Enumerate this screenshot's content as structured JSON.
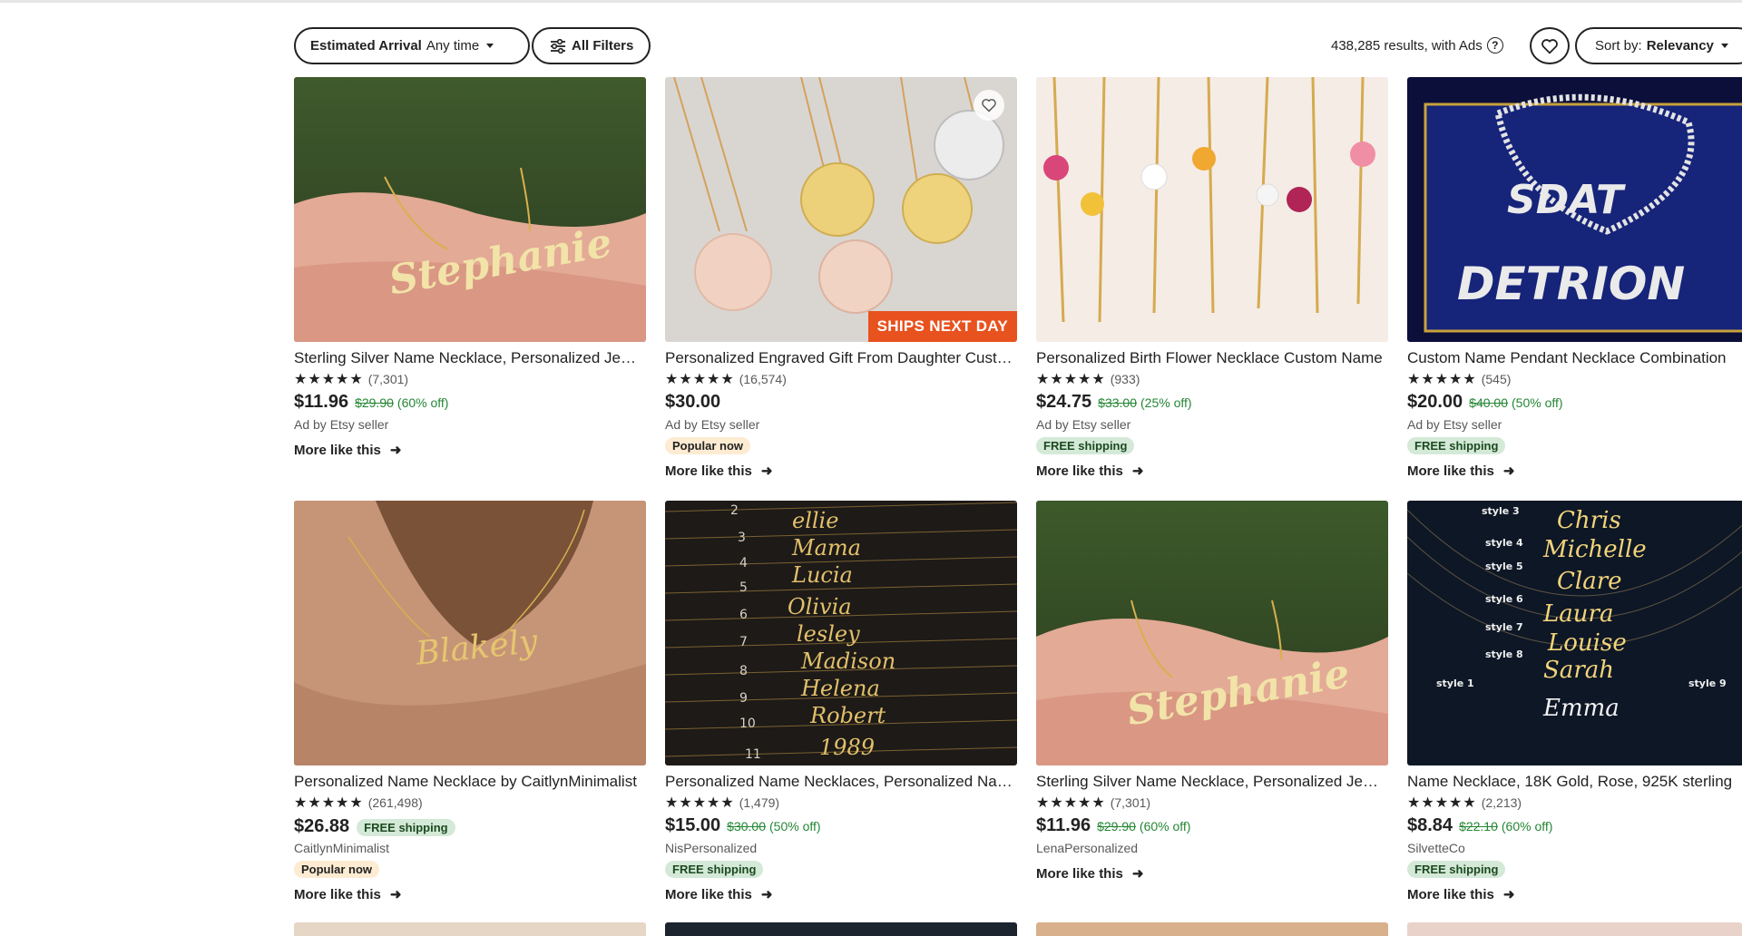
{
  "toolbar": {
    "arrival_label": "Estimated Arrival",
    "arrival_value": "Any time",
    "filters_label": "All Filters",
    "results_text": "438,285 results, with Ads",
    "help_symbol": "?",
    "sort_prefix": "Sort by:",
    "sort_value": "Relevancy"
  },
  "listings": [
    {
      "title": "Sterling Silver Name Necklace, Personalized Jewelry",
      "stars": "★★★★★",
      "reviews": "(7,301)",
      "price": "$11.96",
      "original": "$29.90",
      "discount": "(60% off)",
      "seller": "Ad by Etsy seller",
      "more": "More like this",
      "image_text": "Stephanie"
    },
    {
      "title": "Personalized Engraved Gift From Daughter Custom",
      "stars": "★★★★★",
      "reviews": "(16,574)",
      "price": "$30.00",
      "seller": "Ad by Etsy seller",
      "badge": "Popular now",
      "more": "More like this",
      "overlay": "SHIPS NEXT DAY"
    },
    {
      "title": "Personalized Birth Flower Necklace Custom Name",
      "stars": "★★★★★",
      "reviews": "(933)",
      "price": "$24.75",
      "original": "$33.00",
      "discount": "(25% off)",
      "seller": "Ad by Etsy seller",
      "badge": "FREE shipping",
      "more": "More like this"
    },
    {
      "title": "Custom Name Pendant Necklace Combination",
      "stars": "★★★★★",
      "reviews": "(545)",
      "price": "$20.00",
      "original": "$40.00",
      "discount": "(50% off)",
      "seller": "Ad by Etsy seller",
      "badge": "FREE shipping",
      "more": "More like this",
      "image_text_1": "SDAT",
      "image_text_2": "DETRION"
    },
    {
      "title": "Personalized Name Necklace by CaitlynMinimalist",
      "stars": "★★★★★",
      "reviews": "(261,498)",
      "price": "$26.88",
      "inline_badge": "FREE shipping",
      "seller": "CaitlynMinimalist",
      "badge": "Popular now",
      "more": "More like this",
      "image_text": "Blakely"
    },
    {
      "title": "Personalized Name Necklaces, Personalized Name",
      "stars": "★★★★★",
      "reviews": "(1,479)",
      "price": "$15.00",
      "original": "$30.00",
      "discount": "(50% off)",
      "seller": "NisPersonalized",
      "badge": "FREE shipping",
      "more": "More like this"
    },
    {
      "title": "Sterling Silver Name Necklace, Personalized Jewelry",
      "stars": "★★★★★",
      "reviews": "(7,301)",
      "price": "$11.96",
      "original": "$29.90",
      "discount": "(60% off)",
      "seller": "LenaPersonalized",
      "more": "More like this",
      "image_text": "Stephanie"
    },
    {
      "title": "Name Necklace, 18K Gold, Rose, 925K sterling",
      "stars": "★★★★★",
      "reviews": "(2,213)",
      "price": "$8.84",
      "original": "$22.10",
      "discount": "(60% off)",
      "seller": "SilvetteCo",
      "badge": "FREE shipping",
      "more": "More like this"
    }
  ],
  "colors": {
    "accent_green": "#258635",
    "ships_orange": "#e8521f",
    "badge_green_bg": "#d4e9d7",
    "popular_bg": "#fdebd2"
  }
}
